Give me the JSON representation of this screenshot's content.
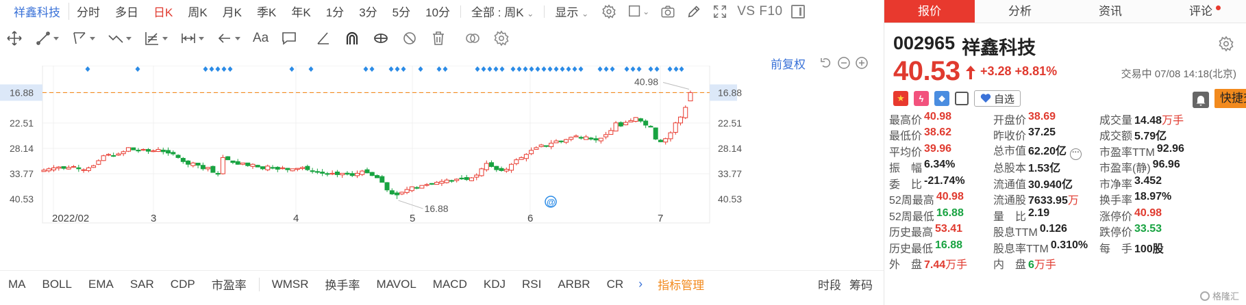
{
  "toolbar": {
    "stock_name": "祥鑫科技",
    "periods": [
      "分时",
      "多日",
      "日K",
      "周K",
      "月K",
      "季K",
      "年K",
      "1分",
      "3分",
      "5分",
      "10分"
    ],
    "active_period": "日K",
    "range_select": "全部 : 周K",
    "display_menu": "显示",
    "vs_f10": "VS F10"
  },
  "chart": {
    "adjust_label": "前复权",
    "price_levels": [
      "40.53",
      "33.77",
      "28.14",
      "22.51",
      "16.88"
    ],
    "current_price_tag": "40.53",
    "high_marker": "40.98",
    "low_marker": "16.88",
    "month_labels": [
      "2022/02",
      "3",
      "4",
      "5",
      "6",
      "7"
    ]
  },
  "chart_data": {
    "type": "candlestick",
    "title": "",
    "ylim": [
      14.0,
      45.0
    ],
    "y_ticks": [
      16.88,
      22.51,
      28.14,
      33.77,
      40.53
    ],
    "x_ticks": [
      "2022/02",
      "3",
      "4",
      "5",
      "6",
      "7"
    ],
    "last_price": 40.53,
    "high": 40.98,
    "low": 16.88,
    "closes": [
      23.3,
      23.6,
      23.8,
      24.0,
      23.7,
      23.9,
      24.1,
      23.6,
      23.4,
      23.8,
      24.3,
      25.4,
      26.5,
      26.8,
      26.4,
      26.9,
      27.4,
      28.3,
      27.8,
      27.6,
      27.9,
      27.5,
      27.6,
      27.9,
      27.4,
      27.1,
      26.9,
      26.1,
      25.2,
      24.6,
      24.9,
      24.4,
      23.6,
      23.9,
      22.8,
      22.4,
      26.1,
      25.6,
      25.0,
      24.6,
      24.9,
      24.3,
      24.6,
      24.0,
      23.6,
      24.2,
      23.8,
      23.5,
      23.8,
      23.4,
      23.6,
      23.7,
      23.9,
      23.4,
      23.0,
      22.9,
      22.6,
      22.4,
      22.6,
      22.3,
      22.6,
      22.4,
      22.1,
      22.6,
      23.1,
      22.7,
      22.1,
      21.6,
      20.6,
      18.9,
      18.0,
      17.8,
      18.4,
      19.0,
      19.6,
      19.4,
      19.9,
      20.1,
      20.3,
      20.6,
      20.8,
      21.1,
      21.0,
      21.3,
      21.4,
      21.2,
      21.6,
      22.2,
      23.6,
      24.8,
      24.1,
      23.4,
      23.2,
      23.5,
      24.6,
      25.6,
      26.1,
      26.8,
      27.7,
      28.3,
      28.9,
      28.6,
      29.3,
      29.8,
      29.6,
      30.1,
      30.6,
      30.9,
      30.4,
      30.7,
      30.2,
      30.0,
      30.4,
      31.2,
      32.1,
      33.8,
      33.1,
      33.9,
      34.3,
      35.0,
      34.2,
      33.3,
      32.9,
      30.2,
      29.6,
      30.3,
      31.6,
      33.8,
      35.1,
      37.25,
      40.53
    ],
    "volume_label_count": 0
  },
  "indicators": {
    "items": [
      "MA",
      "BOLL",
      "EMA",
      "SAR",
      "CDP",
      "市盈率",
      "WMSR",
      "换手率",
      "MAVOL",
      "MACD",
      "KDJ",
      "RSI",
      "ARBR",
      "CR"
    ],
    "manage": "指标管理",
    "right_tabs": [
      "时段",
      "筹码"
    ]
  },
  "panel": {
    "tabs": [
      "报价",
      "分析",
      "资讯",
      "评论"
    ],
    "active_tab": "报价",
    "code": "002965",
    "name": "祥鑫科技",
    "price": "40.53",
    "change": "+3.28  +8.81%",
    "trade_time": "交易中 07/08 14:18(北京)",
    "watch_label": "自选",
    "quick_trade": "快捷交易",
    "stats": [
      [
        {
          "label": "最高价",
          "value": "40.98",
          "color": "red"
        },
        {
          "label": "开盘价",
          "value": "38.69",
          "color": "red"
        },
        {
          "label": "成交量",
          "value": "14.48",
          "unit": "万手",
          "color": "black"
        }
      ],
      [
        {
          "label": "最低价",
          "value": "38.62",
          "color": "red"
        },
        {
          "label": "昨收价",
          "value": "37.25",
          "color": "black"
        },
        {
          "label": "成交额",
          "value": "5.79亿",
          "color": "black"
        }
      ],
      [
        {
          "label": "平均价",
          "value": "39.96",
          "color": "red"
        },
        {
          "label": "总市值",
          "value": "62.20亿",
          "color": "black"
        },
        {
          "label": "市盈率TTM",
          "value": "92.96",
          "color": "black"
        }
      ],
      [
        {
          "label": "振　幅",
          "value": "6.34%",
          "color": "black"
        },
        {
          "label": "总股本",
          "value": "1.53亿",
          "color": "black"
        },
        {
          "label": "市盈率(静)",
          "value": "96.96",
          "color": "black"
        }
      ],
      [
        {
          "label": "委　比",
          "value": "-21.74%",
          "color": "black"
        },
        {
          "label": "流通值",
          "value": "30.940亿",
          "color": "black"
        },
        {
          "label": "市净率",
          "value": "3.452",
          "color": "black"
        }
      ],
      [
        {
          "label": "52周最高",
          "value": "40.98",
          "color": "red"
        },
        {
          "label": "流通股",
          "value": "7633.95",
          "unit": "万",
          "color": "black"
        },
        {
          "label": "换手率",
          "value": "18.97%",
          "color": "black"
        }
      ],
      [
        {
          "label": "52周最低",
          "value": "16.88",
          "color": "green"
        },
        {
          "label": "量　比",
          "value": "2.19",
          "color": "black"
        },
        {
          "label": "涨停价",
          "value": "40.98",
          "color": "red"
        }
      ],
      [
        {
          "label": "历史最高",
          "value": "53.41",
          "color": "red"
        },
        {
          "label": "股息TTM",
          "value": "0.126",
          "color": "black"
        },
        {
          "label": "跌停价",
          "value": "33.53",
          "color": "green"
        }
      ],
      [
        {
          "label": "历史最低",
          "value": "16.88",
          "color": "green"
        },
        {
          "label": "股息率TTM",
          "value": "0.310%",
          "color": "black"
        },
        {
          "label": "每　手",
          "value": "100股",
          "color": "black"
        }
      ],
      [
        {
          "label": "外　盘",
          "value": "7.44",
          "unit": "万手",
          "color": "red"
        },
        {
          "label": "内　盘",
          "value": "6",
          "unit": "万手",
          "color": "green"
        },
        {
          "label": "",
          "value": "",
          "color": "black"
        }
      ]
    ],
    "watermark": "格隆汇"
  }
}
